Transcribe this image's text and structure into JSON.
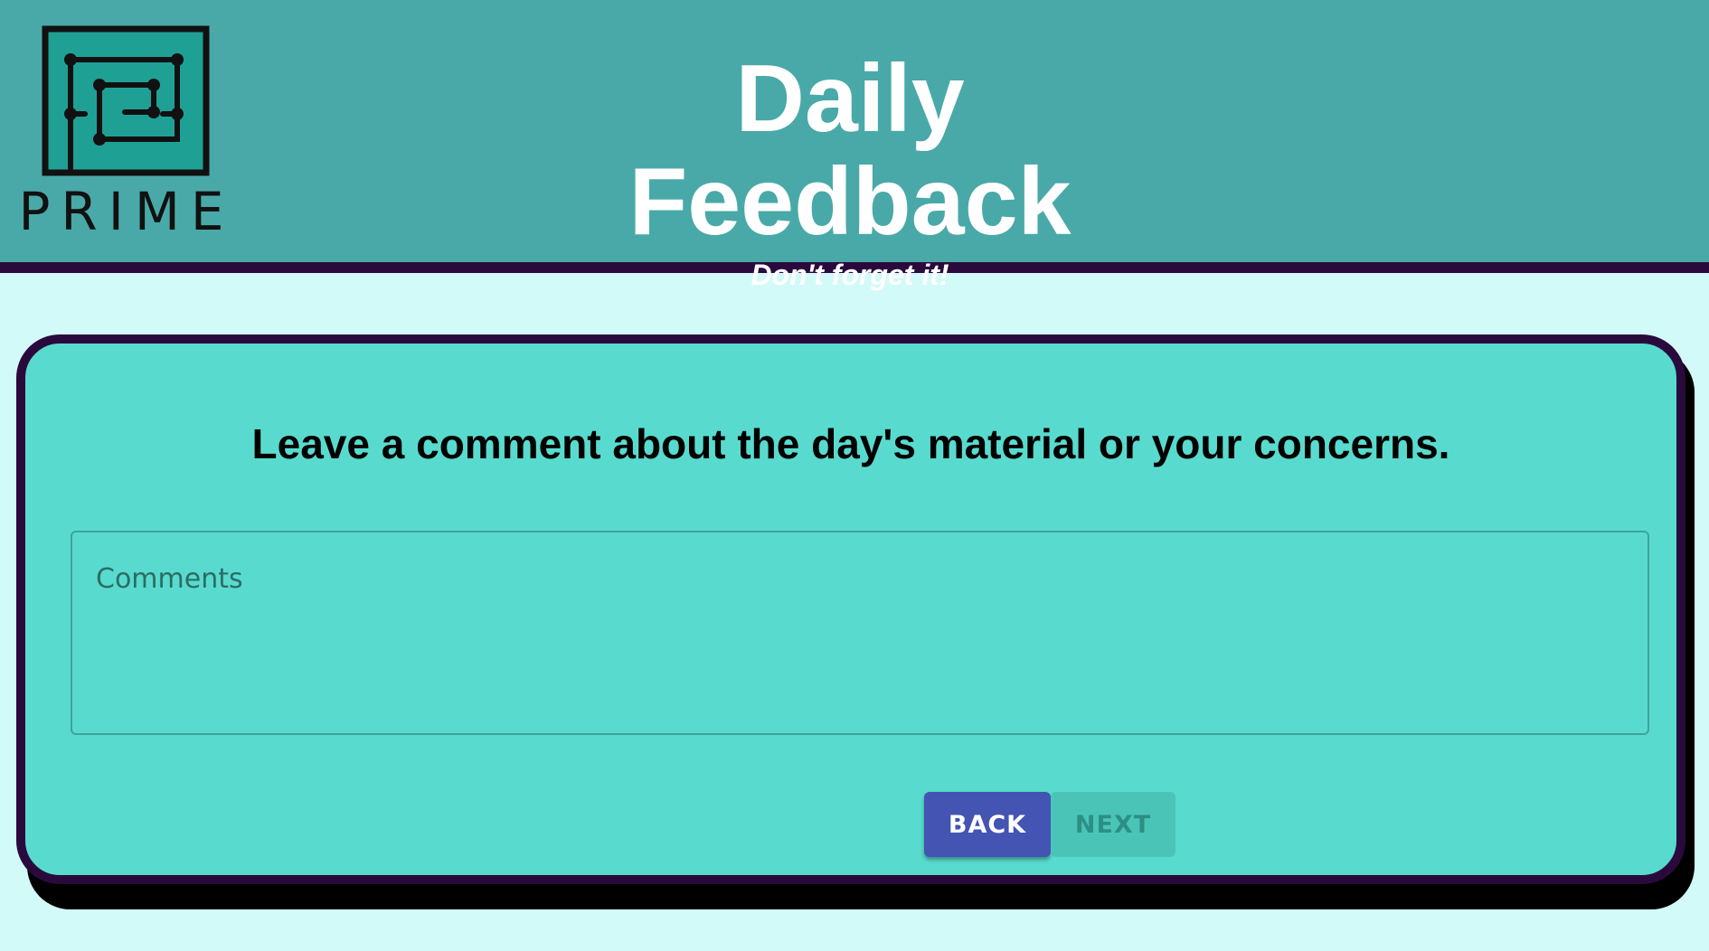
{
  "header": {
    "logo_text": "PRIME",
    "title": "Daily Feedback",
    "subtitle": "Don't forget it!"
  },
  "card": {
    "question": "Leave a comment about the day's material or your concerns.",
    "comments": {
      "placeholder": "Comments",
      "value": ""
    },
    "back_label": "BACK",
    "next_label": "NEXT",
    "next_disabled": true
  },
  "colors": {
    "header_bg": "#49a9a8",
    "header_border": "#2a0a3c",
    "page_bg": "#d2faf9",
    "card_bg": "#58dbce",
    "back_button": "#4354b3",
    "next_button_disabled": "#4bc4b8"
  }
}
